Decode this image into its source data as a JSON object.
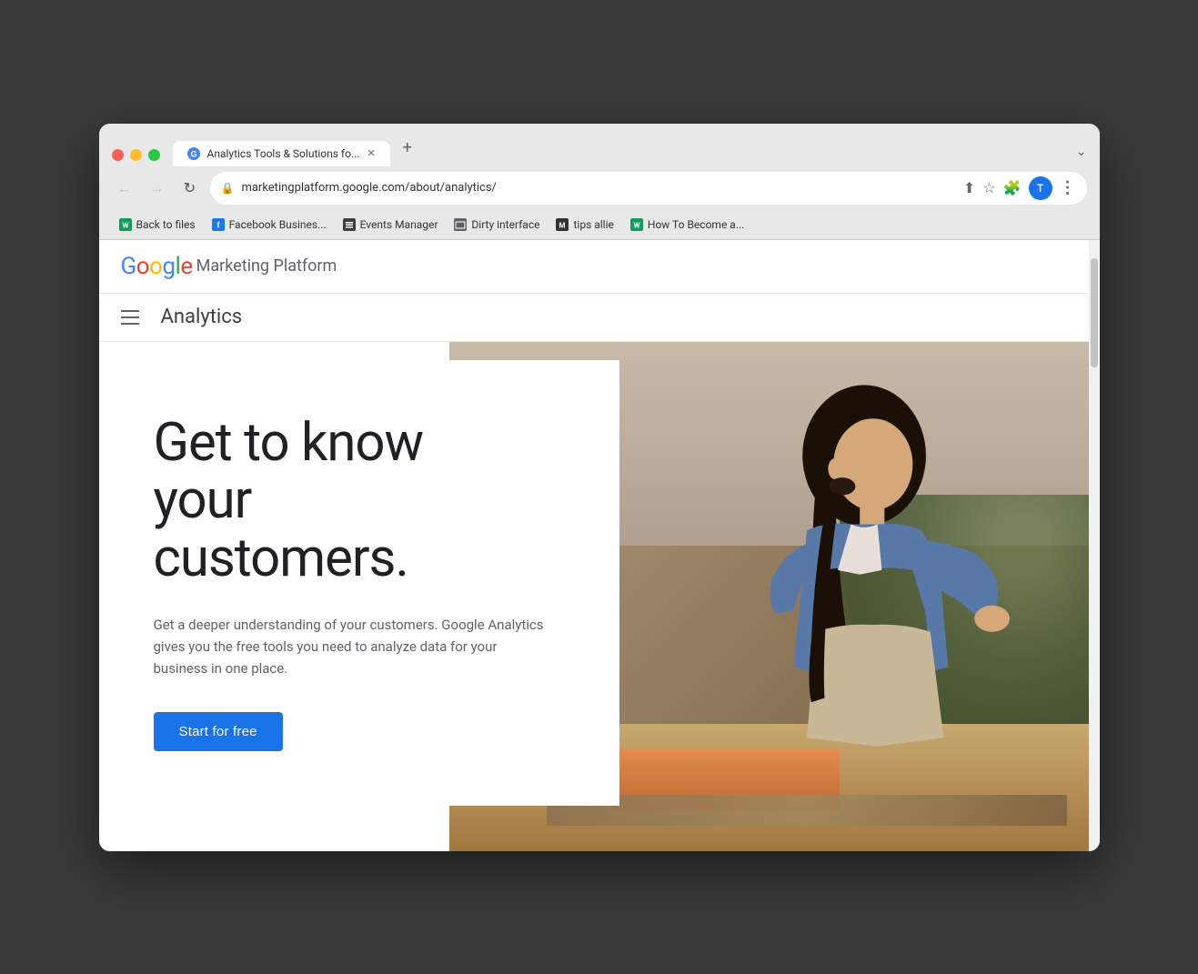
{
  "browser": {
    "tab": {
      "title": "Analytics Tools & Solutions fo...",
      "favicon_letter": "G"
    },
    "address": "marketingplatform.google.com/about/analytics/",
    "new_tab_label": "+",
    "overflow_label": "⌄",
    "nav": {
      "back_label": "←",
      "forward_label": "→",
      "reload_label": "↻"
    },
    "address_actions": {
      "share": "⬆",
      "bookmark": "☆",
      "extension": "🧩",
      "kebab": "⋮"
    },
    "avatar_letter": "T"
  },
  "bookmarks": [
    {
      "id": "back-to-files",
      "icon": "W",
      "label": "Back to files"
    },
    {
      "id": "facebook-business",
      "icon": "f",
      "label": "Facebook Busines..."
    },
    {
      "id": "events-manager",
      "icon": "☰",
      "label": "Events Manager"
    },
    {
      "id": "dirty-interface",
      "icon": "📁",
      "label": "Dirty interface"
    },
    {
      "id": "tips-allie",
      "icon": "M",
      "label": "tips allie"
    },
    {
      "id": "how-to-become",
      "icon": "W",
      "label": "How To Become a..."
    }
  ],
  "gmp_header": {
    "logo_letters": {
      "G": "G",
      "o1": "o",
      "o2": "o",
      "g": "g",
      "l": "l",
      "e": "e"
    },
    "platform_text": "Marketing Platform"
  },
  "analytics_nav": {
    "title": "Analytics"
  },
  "hero": {
    "headline_line1": "Get to know",
    "headline_line2": "your",
    "headline_line3": "customers.",
    "subtext": "Get a deeper understanding of your customers. Google Analytics gives you the free tools you need to analyze data for your business in one place.",
    "cta_label": "Start for free"
  }
}
